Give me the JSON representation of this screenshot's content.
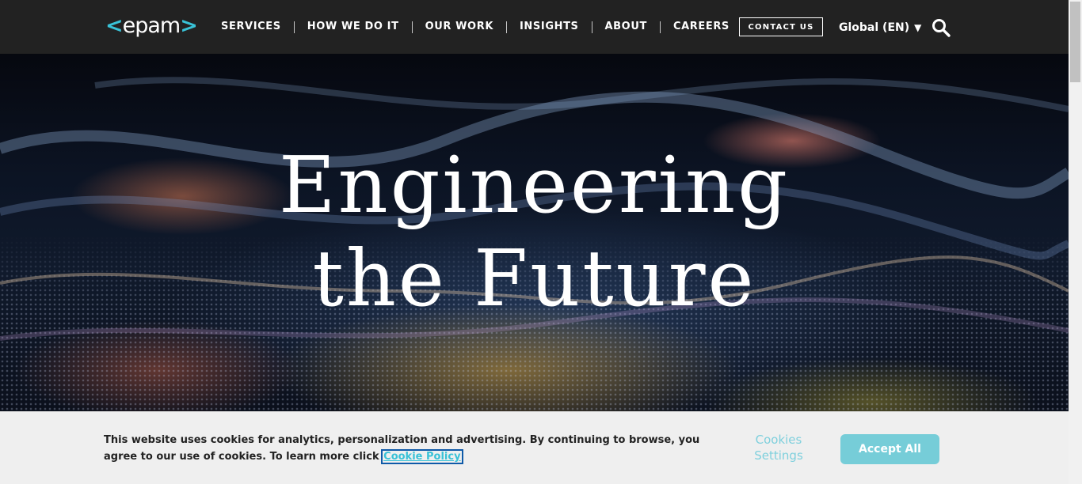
{
  "header": {
    "logo_text": "epam",
    "logo_left_bracket": "<",
    "logo_right_bracket": ">",
    "nav": [
      {
        "label": "SERVICES"
      },
      {
        "label": "HOW WE DO IT"
      },
      {
        "label": "OUR WORK"
      },
      {
        "label": "INSIGHTS"
      },
      {
        "label": "ABOUT"
      },
      {
        "label": "CAREERS"
      }
    ],
    "contact_label": "CONTACT US",
    "language_label": "Global (EN)",
    "language_caret": "▼",
    "search_icon": "search-icon"
  },
  "hero": {
    "title_line1": "Engineering",
    "title_line2": "the Future"
  },
  "cookie": {
    "text": "This website uses cookies for analytics, personalization and advertising. By continuing to browse, you agree to our use of cookies. To learn more click ",
    "link_label": "Cookie Policy",
    "settings_label": "Cookies Settings",
    "accept_label": "Accept All"
  },
  "colors": {
    "header_bg": "#222222",
    "accent": "#39c2d7",
    "accept_button": "#76cdd8",
    "banner_bg": "#efefef"
  }
}
